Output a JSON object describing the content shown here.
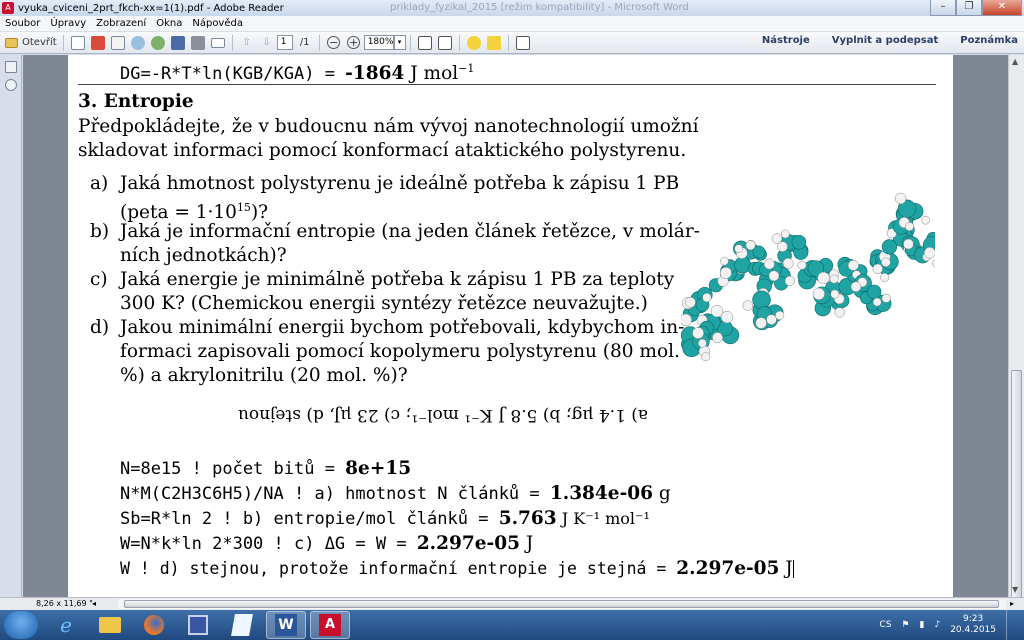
{
  "window": {
    "title": "vyuka_cviceni_2prt_fkch-xx=1(1).pdf - Adobe Reader",
    "background_title": "priklady_fyzikal_2015 [režim kompatibility] - Microsoft Word"
  },
  "menu": [
    "Soubor",
    "Úpravy",
    "Zobrazení",
    "Okna",
    "Nápověda"
  ],
  "toolbar": {
    "open_label": "Otevřít",
    "page_current": "1",
    "page_total": "/1",
    "zoom": "180%",
    "right_links": [
      "Nástroje",
      "Vyplnit a podepsat",
      "Poznámka"
    ]
  },
  "document": {
    "top_line_code": "DG=-R*T*ln(KGB/KGA) = ",
    "top_line_value": "-1864",
    "top_line_unit": "J mol",
    "top_line_exp": "−1",
    "heading": "3. Entropie",
    "intro_1": "Předpokládejte, že v budoucnu nám vývoj nanotechnologií umožní",
    "intro_2": "skladovat informaci pomocí konformací ataktického polystyrenu.",
    "q_a_marker": "a)",
    "q_a_1": "Jaká hmotnost polystyrenu je ideálně potřeba k zápisu 1 PB",
    "q_a_2": "(peta = 1·10",
    "q_a_2_exp": "15",
    "q_a_2_end": ")?",
    "q_b_marker": "b)",
    "q_b_1": "Jaká je informační entropie (na jeden článek řetězce, v molár-",
    "q_b_2": "ních jednotkách)?",
    "q_c_marker": "c)",
    "q_c_1": "Jaká energie je minimálně potřeba k zápisu 1 PB za teploty",
    "q_c_2": "300 K? (Chemickou energii syntézy řetězce neuvažujte.)",
    "q_d_marker": "d)",
    "q_d_1": "Jakou minimální energii bychom potřebovali, kdybychom in-",
    "q_d_2": "formaci zapisovali pomocí kopolymeru polystyrenu (80 mol.",
    "q_d_3": "%) a akrylonitrilu (20 mol. %)?",
    "answers_inverted": "a) 1.4 μg; b) 5.8 J K⁻¹ mol⁻¹; c) 23 μJ, d) stejnou",
    "calc": [
      {
        "code": "N=8e15 ! počet bitů = ",
        "value": "8e+15",
        "unit": ""
      },
      {
        "code": "N*M(C2H3C6H5)/NA ! a) hmotnost N článků = ",
        "value": "1.384e-06",
        "unit": " g"
      },
      {
        "code": "Sb=R*ln 2 ! b) entropie/mol článků = ",
        "value": "5.763",
        "unit": " J K⁻¹ mol⁻¹"
      },
      {
        "code": "W=N*k*ln 2*300 ! c) ΔG = W = ",
        "value": "2.297e-05",
        "unit": " J"
      },
      {
        "code": "W ! d) stejnou, protože informační entropie je stejná = ",
        "value": "2.297e-05",
        "unit": " J"
      }
    ]
  },
  "status": {
    "page_size": "8,26 x 11,69 \""
  },
  "taskbar": {
    "lang": "CS",
    "time": "9:23",
    "date": "20.4.2015"
  },
  "colors": {
    "molecule_carbon": "#1fa3a3",
    "molecule_hydrogen": "#f2f2f2",
    "close_button": "#c7442a"
  }
}
